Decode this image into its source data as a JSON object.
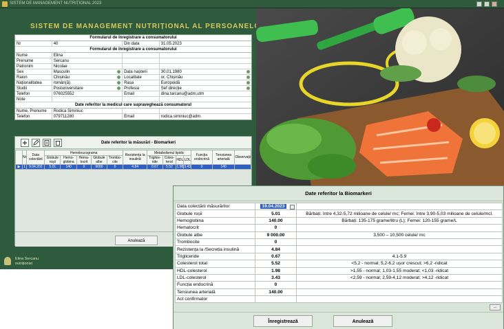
{
  "window": {
    "title": "SISTEM DE MANAGEMENT NUTRIȚIONAL 2023"
  },
  "app": {
    "heading": "SISTEM DE MANAGEMENT NUTRIȚIONAL AL PERSOANELOR CU TACG"
  },
  "form": {
    "section1": "Formularul de înregistrare a consumatorului",
    "nr_label": "Nr",
    "nr_value": "40",
    "date_label": "Din data",
    "date_value": "31.05.2023",
    "section2": "Formularul de înregistrare a consumatorului",
    "rows": [
      {
        "l1": "Nume",
        "v1": "Elina",
        "l2": "",
        "v2": ""
      },
      {
        "l1": "Prenume",
        "v1": "Sercanu",
        "l2": "",
        "v2": ""
      },
      {
        "l1": "Patronim",
        "v1": "Nicolae",
        "l2": "",
        "v2": ""
      },
      {
        "l1": "Sex",
        "v1": "Masculin",
        "l2": "Data nașterii",
        "v2": "30.01.1980"
      },
      {
        "l1": "Raion",
        "v1": "Chișinău",
        "l2": "Localitate",
        "v2": "or. Chișinău"
      },
      {
        "l1": "Naționalitatea",
        "v1": "român(ă)",
        "l2": "Rasa",
        "v2": "Europoidă"
      },
      {
        "l1": "Studii",
        "v1": "Postuniversitare",
        "l2": "Profesia",
        "v2": "Șef direcție"
      },
      {
        "l1": "Telefon",
        "v1": "076025552",
        "l2": "Email",
        "v2": "dina.tarcanu@adm.utm"
      },
      {
        "l1": "Note",
        "v1": "",
        "l2": "",
        "v2": ""
      }
    ],
    "section3": "Date referitor la medicul care supraveghează consumatorul",
    "doc_name_label": "Nume, Prenume",
    "doc_name_value": "Rodica Siminiuc",
    "doc_tel_label": "Telefon",
    "doc_tel_value": "079711280",
    "doc_email_label": "Email",
    "doc_email_value": "rodica.siminiuc@adm."
  },
  "grid": {
    "title": "Date referitor la măsurări - Biomarkeri",
    "headers": [
      "Nr",
      "Data colectării",
      "Globule roșii",
      "Hemo-globina",
      "Hema-tocrit",
      "Globule albe",
      "Trombo-cite",
      "Rezistența la insulină",
      "Triglice-ride",
      "Coles-terol",
      "HDL",
      "LDL",
      "Funcția endocrină",
      "Tensiunea arterială",
      "Observații"
    ],
    "group_hemo": "Hemoleucograma",
    "group_meta": "Metabolismul lipidic",
    "row": [
      "1",
      "9.04.202",
      "5.01",
      "140",
      "0",
      "9000",
      "0",
      "4.84",
      "0.67",
      "5.52",
      "1.98",
      "3.43",
      "0",
      "140",
      ""
    ],
    "cancel_label": "Anulează"
  },
  "status": {
    "user_text": "Elina Sercanu nutriționist"
  },
  "dialog": {
    "title": "Date referitor la Biomarkeri",
    "date_label": "Data colectării măsurărilor",
    "date_value": "19.04.2023",
    "rows": [
      {
        "label": "Globule roșii",
        "value": "5.01",
        "ref": "Bărbați: între 4,32-5,72 milioane de celule/ mc; Femei: între 3,90-5,03 milioane de celule/mcl."
      },
      {
        "label": "Hemoglobina",
        "value": "140.00",
        "ref": "Bărbați: 135-175 grame/litru (L); Femei: 120-155 grame/L"
      },
      {
        "label": "Hematocrit",
        "value": "0",
        "ref": ""
      },
      {
        "label": "Globule albe",
        "value": "9 000.00",
        "ref": "3,500 – 10,500 celule/ mc"
      },
      {
        "label": "Trombocite",
        "value": "0",
        "ref": ""
      },
      {
        "label": "Rezistența la /Secreția insulină",
        "value": "4.84",
        "ref": ""
      },
      {
        "label": "Trigliceride",
        "value": "0.67",
        "ref": "4.1-5.9"
      },
      {
        "label": "Colesterol total",
        "value": "5.52",
        "ref": "<5,2 - normal; 5,2-6,2 ușor crescut; >6,2 -ridicat"
      },
      {
        "label": "HDL-colesterol",
        "value": "1.98",
        "ref": ">1,55 - normal; 1,03-1,55 moderat; <1,03 -ridicat"
      },
      {
        "label": "LDL-colesterol",
        "value": "3.43",
        "ref": "<2,59 - normal; 2,59-4,12 moderat; >4,12 -ridicat"
      },
      {
        "label": "Funcția endocrină",
        "value": "0",
        "ref": ""
      },
      {
        "label": "Tensiunea arterială",
        "value": "140.00",
        "ref": ""
      },
      {
        "label": "Act confirmator",
        "value": "",
        "ref": ""
      }
    ],
    "dots_label": "...",
    "save_label": "Înregistrează",
    "cancel_label": "Anulează"
  },
  "colors": {
    "app_green": "#2e5a3e",
    "heading_yellow": "#d7c95a",
    "selection_blue": "#2f5fc4"
  }
}
